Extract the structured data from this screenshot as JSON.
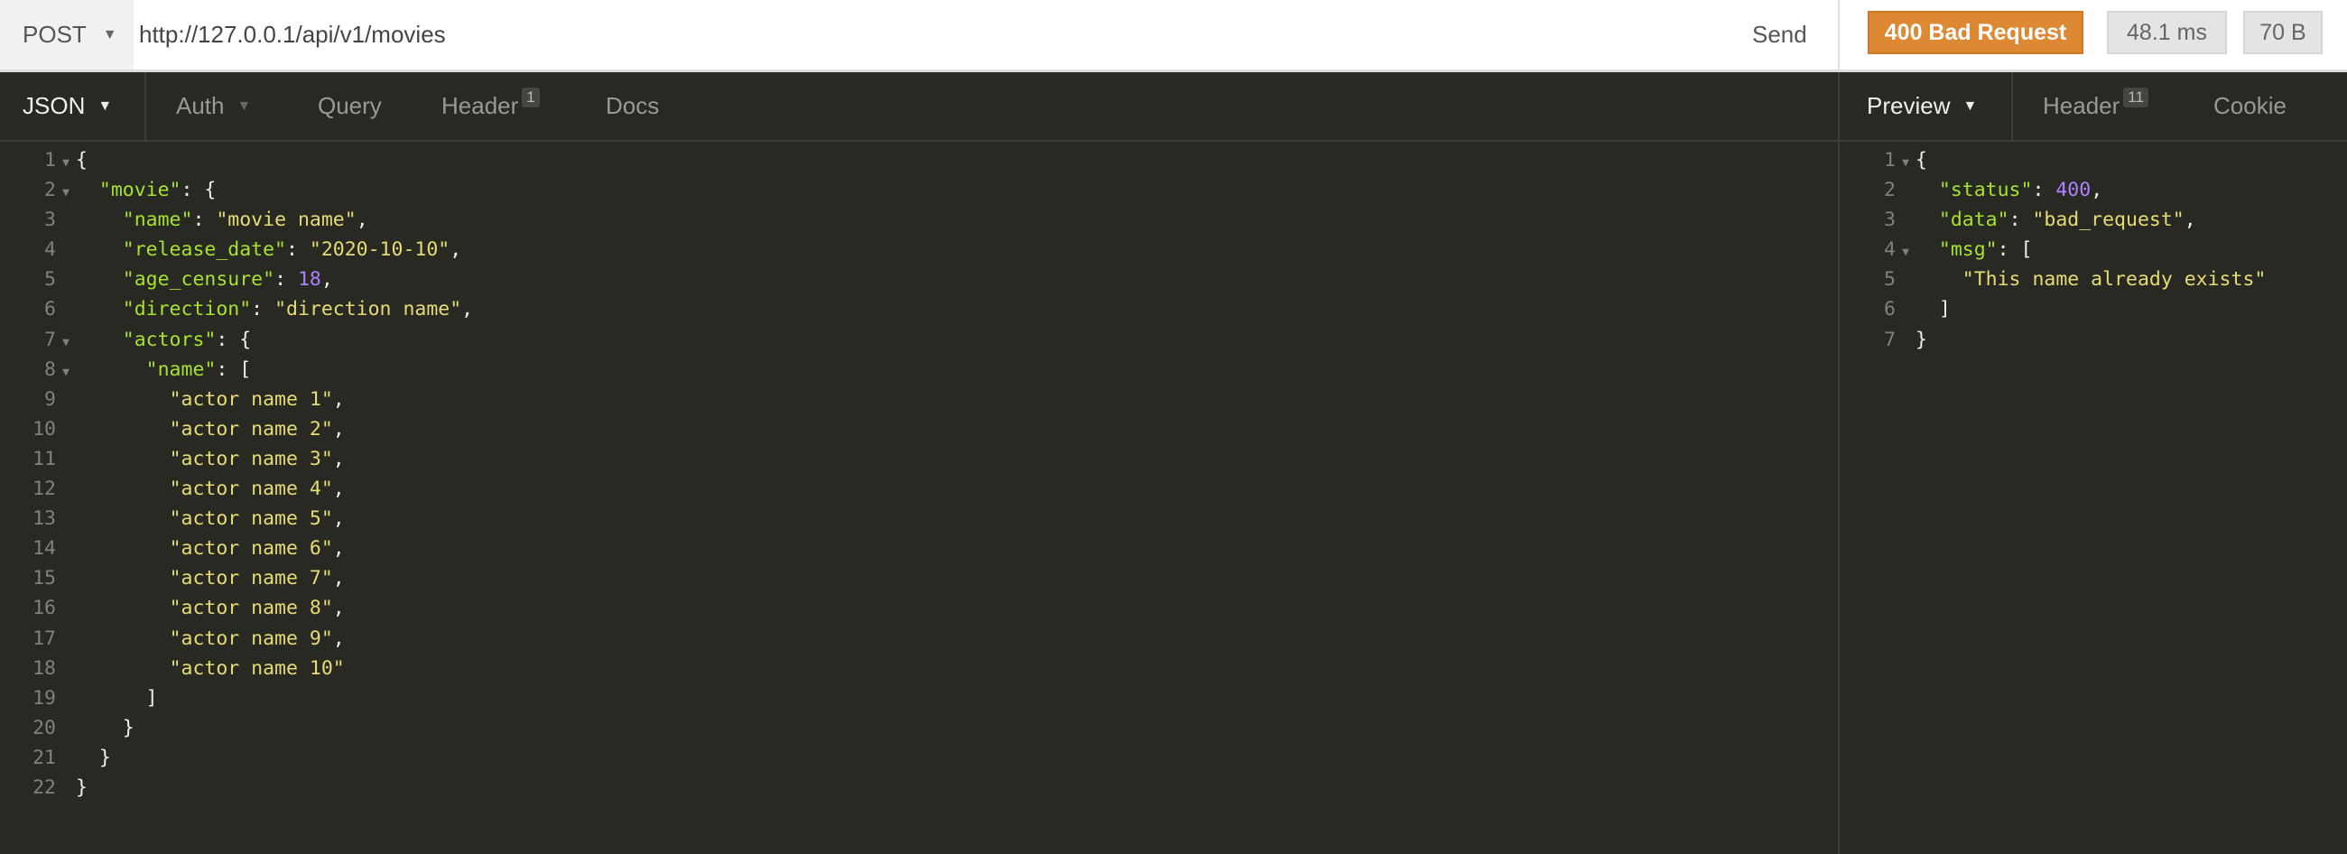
{
  "request": {
    "method": "POST",
    "url": "http://127.0.0.1/api/v1/movies",
    "send_label": "Send"
  },
  "response": {
    "status": "400 Bad Request",
    "time": "48.1 ms",
    "size": "70 B",
    "status_color": "#dd8833"
  },
  "request_tabs": [
    {
      "label": "JSON",
      "dropdown": true,
      "active": true
    },
    {
      "label": "Auth",
      "dropdown": true
    },
    {
      "label": "Query"
    },
    {
      "label": "Header",
      "badge": "1"
    },
    {
      "label": "Docs"
    }
  ],
  "response_tabs": [
    {
      "label": "Preview",
      "dropdown": true,
      "active": true
    },
    {
      "label": "Header",
      "badge": "11"
    },
    {
      "label": "Cookie"
    }
  ],
  "request_body": [
    [
      [
        "p",
        "{"
      ]
    ],
    [
      [
        "p",
        "  "
      ],
      [
        "k",
        "\"movie\""
      ],
      [
        "p",
        ": {"
      ]
    ],
    [
      [
        "p",
        "    "
      ],
      [
        "k",
        "\"name\""
      ],
      [
        "p",
        ": "
      ],
      [
        "s",
        "\"movie name\""
      ],
      [
        "p",
        ","
      ]
    ],
    [
      [
        "p",
        "    "
      ],
      [
        "k",
        "\"release_date\""
      ],
      [
        "p",
        ": "
      ],
      [
        "s",
        "\"2020-10-10\""
      ],
      [
        "p",
        ","
      ]
    ],
    [
      [
        "p",
        "    "
      ],
      [
        "k",
        "\"age_censure\""
      ],
      [
        "p",
        ": "
      ],
      [
        "n",
        "18"
      ],
      [
        "p",
        ","
      ]
    ],
    [
      [
        "p",
        "    "
      ],
      [
        "k",
        "\"direction\""
      ],
      [
        "p",
        ": "
      ],
      [
        "s",
        "\"direction name\""
      ],
      [
        "p",
        ","
      ]
    ],
    [
      [
        "p",
        "    "
      ],
      [
        "k",
        "\"actors\""
      ],
      [
        "p",
        ": {"
      ]
    ],
    [
      [
        "p",
        "      "
      ],
      [
        "k",
        "\"name\""
      ],
      [
        "p",
        ": ["
      ]
    ],
    [
      [
        "p",
        "        "
      ],
      [
        "s",
        "\"actor name 1\""
      ],
      [
        "p",
        ","
      ]
    ],
    [
      [
        "p",
        "        "
      ],
      [
        "s",
        "\"actor name 2\""
      ],
      [
        "p",
        ","
      ]
    ],
    [
      [
        "p",
        "        "
      ],
      [
        "s",
        "\"actor name 3\""
      ],
      [
        "p",
        ","
      ]
    ],
    [
      [
        "p",
        "        "
      ],
      [
        "s",
        "\"actor name 4\""
      ],
      [
        "p",
        ","
      ]
    ],
    [
      [
        "p",
        "        "
      ],
      [
        "s",
        "\"actor name 5\""
      ],
      [
        "p",
        ","
      ]
    ],
    [
      [
        "p",
        "        "
      ],
      [
        "s",
        "\"actor name 6\""
      ],
      [
        "p",
        ","
      ]
    ],
    [
      [
        "p",
        "        "
      ],
      [
        "s",
        "\"actor name 7\""
      ],
      [
        "p",
        ","
      ]
    ],
    [
      [
        "p",
        "        "
      ],
      [
        "s",
        "\"actor name 8\""
      ],
      [
        "p",
        ","
      ]
    ],
    [
      [
        "p",
        "        "
      ],
      [
        "s",
        "\"actor name 9\""
      ],
      [
        "p",
        ","
      ]
    ],
    [
      [
        "p",
        "        "
      ],
      [
        "s",
        "\"actor name 10\""
      ]
    ],
    [
      [
        "p",
        "      ]"
      ]
    ],
    [
      [
        "p",
        "    }"
      ]
    ],
    [
      [
        "p",
        "  }"
      ]
    ],
    [
      [
        "p",
        "}"
      ]
    ]
  ],
  "request_folds": [
    1,
    2,
    7,
    8
  ],
  "response_body": [
    [
      [
        "p",
        "{"
      ]
    ],
    [
      [
        "p",
        "  "
      ],
      [
        "k",
        "\"status\""
      ],
      [
        "p",
        ": "
      ],
      [
        "n",
        "400"
      ],
      [
        "p",
        ","
      ]
    ],
    [
      [
        "p",
        "  "
      ],
      [
        "k",
        "\"data\""
      ],
      [
        "p",
        ": "
      ],
      [
        "s",
        "\"bad_request\""
      ],
      [
        "p",
        ","
      ]
    ],
    [
      [
        "p",
        "  "
      ],
      [
        "k",
        "\"msg\""
      ],
      [
        "p",
        ": ["
      ]
    ],
    [
      [
        "p",
        "    "
      ],
      [
        "s",
        "\"This name already exists\""
      ]
    ],
    [
      [
        "p",
        "  ]"
      ]
    ],
    [
      [
        "p",
        "}"
      ]
    ]
  ],
  "response_folds": [
    1,
    4
  ]
}
